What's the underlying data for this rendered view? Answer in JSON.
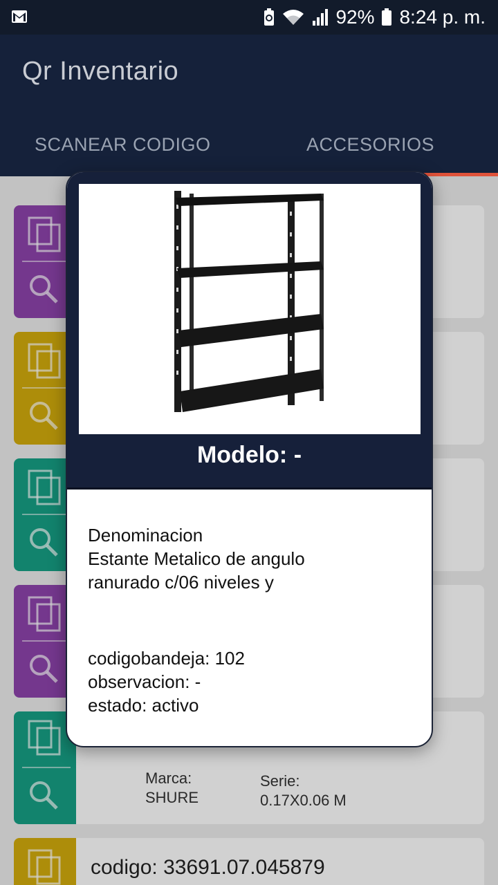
{
  "status_bar": {
    "battery": "92%",
    "time": "8:24 p. m.",
    "icons": [
      "gmail-icon",
      "battery-saver-icon",
      "wifi-icon",
      "signal-icon",
      "battery-icon"
    ]
  },
  "app_bar": {
    "title": "Qr Inventario",
    "actions": [
      "account-icon",
      "plug-icon",
      "more-vert-icon"
    ]
  },
  "tabs": [
    {
      "label": "SCANEAR CODIGO",
      "selected": false
    },
    {
      "label": "ACCESORIOS",
      "selected": true
    }
  ],
  "colors": {
    "app_bar": "#15213a",
    "tab_indicator": "#e0533a",
    "purple": "#8e44ad",
    "yellow": "#d4ac0d",
    "teal": "#16a085"
  },
  "list": {
    "card5": {
      "marca_label": "Marca:",
      "marca_value": "SHURE",
      "serie_label": "Serie:",
      "serie_value": "0.17X0.06 M"
    },
    "card6": {
      "codigo": "codigo: 33691.07.045879"
    }
  },
  "dialog": {
    "image": "metal-shelf-image",
    "modelo": "Modelo: -",
    "denominacion_label": "Denominacion",
    "denominacion_line1": "Estante Metalico de angulo",
    "denominacion_line2": "ranurado c/06 niveles y",
    "codigobandeja": "codigobandeja: 102",
    "observacion": "observacion: -",
    "estado": "estado: activo"
  }
}
